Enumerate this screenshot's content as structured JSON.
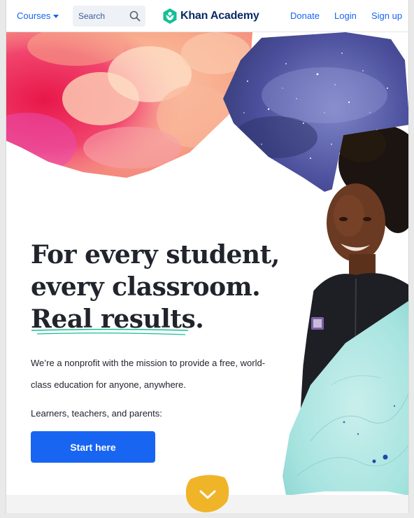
{
  "nav": {
    "courses_label": "Courses",
    "search_placeholder": "Search",
    "logo_text": "Khan Academy",
    "donate_label": "Donate",
    "login_label": "Login",
    "signup_label": "Sign up"
  },
  "hero": {
    "headline_line1": "For every student,",
    "headline_line2": "every classroom.",
    "headline_line3": "Real results.",
    "mission_text": "We’re a nonprofit with the mission to provide a free, world-class education for anyone, anywhere.",
    "audience_text": "Learners, teachers, and parents:",
    "cta_label": "Start here"
  },
  "colors": {
    "brand_blue": "#1865f2",
    "logo_green": "#14bf96",
    "text_dark": "#21242c",
    "scroll_yellow": "#f0b429"
  },
  "icons": [
    "chevron-down-icon",
    "search-icon",
    "khan-logo-icon",
    "caret-down-icon"
  ]
}
